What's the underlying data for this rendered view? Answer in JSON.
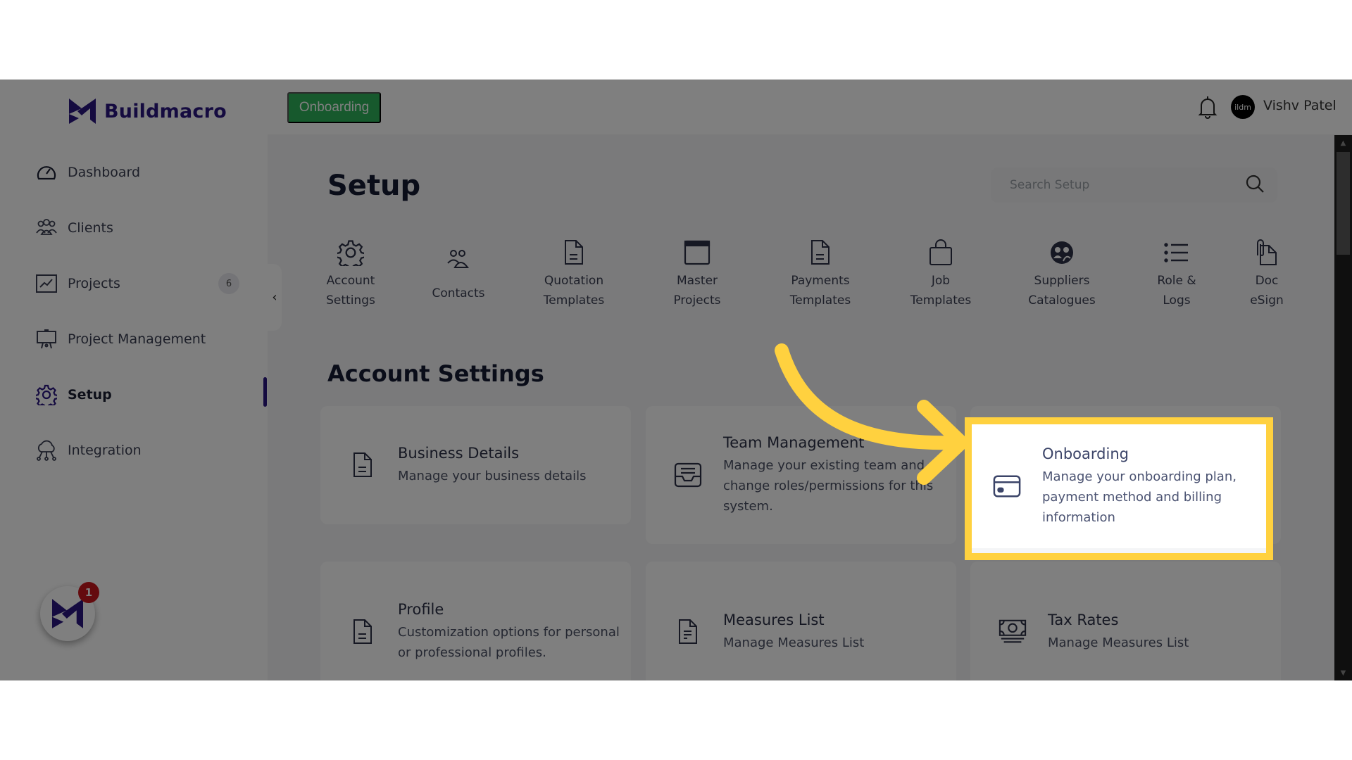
{
  "app": {
    "brand": "Buildmacro",
    "brand_color": "#2a1680",
    "accent_green": "#2fb35a",
    "highlight_color": "#ffd13f"
  },
  "sidebar": {
    "items": [
      {
        "label": "Dashboard",
        "icon": "dashboard-gauge-icon"
      },
      {
        "label": "Clients",
        "icon": "users-group-icon"
      },
      {
        "label": "Projects",
        "icon": "chart-line-icon",
        "badge": "6"
      },
      {
        "label": "Project Management",
        "icon": "presentation-board-icon"
      },
      {
        "label": "Setup",
        "icon": "gear-icon",
        "active": true
      },
      {
        "label": "Integration",
        "icon": "cloud-network-icon"
      }
    ],
    "collapse_label": "‹",
    "chat_badge": "1"
  },
  "topbar": {
    "onboarding_label": "Onboarding",
    "avatar_text": "ildm",
    "user_name": "Vishv Patel"
  },
  "main": {
    "title": "Setup",
    "search": {
      "placeholder": "Search Setup",
      "value": ""
    },
    "tabs": [
      {
        "label": "Account\nSettings",
        "icon": "gear-icon"
      },
      {
        "label": "Contacts",
        "icon": "contacts-icon"
      },
      {
        "label": "Quotation\nTemplates",
        "icon": "document-icon"
      },
      {
        "label": "Master\nProjects",
        "icon": "window-icon"
      },
      {
        "label": "Payments\nTemplates",
        "icon": "document-icon"
      },
      {
        "label": "Job\nTemplates",
        "icon": "bag-icon"
      },
      {
        "label": "Suppliers\nCatalogues",
        "icon": "suppliers-icon"
      },
      {
        "label": "Role &\nLogs",
        "icon": "list-icon"
      },
      {
        "label": "Doc\neSign",
        "icon": "paperclip-document-icon"
      }
    ],
    "section_title": "Account Settings",
    "cards": [
      {
        "title": "Business Details",
        "desc": "Manage your business details",
        "icon": "document-icon"
      },
      {
        "title": "Team Management",
        "desc": "Manage your existing team and change roles/permissions for this system.",
        "icon": "inbox-tray-icon"
      },
      {
        "title": "Onboarding",
        "desc": "Manage your onboarding plan, payment method and billing information",
        "icon": "credit-card-icon",
        "highlighted": true
      },
      {
        "title": "Profile",
        "desc": "Customization options for personal or professional profiles.",
        "icon": "document-icon"
      },
      {
        "title": "Measures List",
        "desc": "Manage Measures List",
        "icon": "document-icon"
      },
      {
        "title": "Tax Rates",
        "desc": "Manage Measures List",
        "icon": "money-stack-icon"
      }
    ]
  }
}
